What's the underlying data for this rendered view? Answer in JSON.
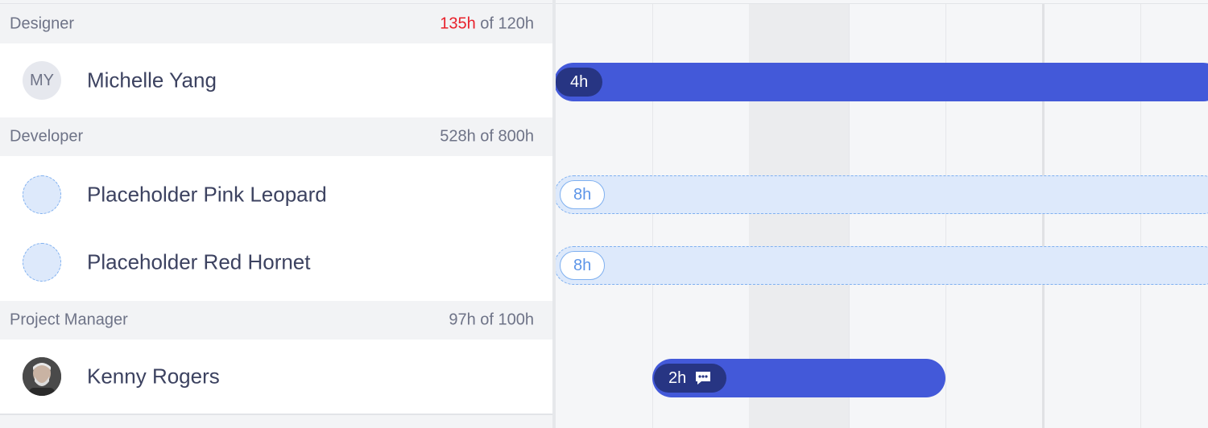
{
  "roles": [
    {
      "name": "Designer",
      "hours_used": "135h",
      "hours_rest": " of 120h",
      "over_budget": true,
      "people": [
        {
          "name": "Michelle Yang",
          "avatar_type": "initials",
          "initials": "MY",
          "booking_label": "4h"
        }
      ]
    },
    {
      "name": "Developer",
      "hours_used": "528h",
      "hours_rest": " of 800h",
      "over_budget": false,
      "people": [
        {
          "name": "Placeholder Pink Leopard",
          "avatar_type": "placeholder",
          "booking_label": "8h"
        },
        {
          "name": "Placeholder Red Hornet",
          "avatar_type": "placeholder",
          "booking_label": "8h"
        }
      ]
    },
    {
      "name": "Project Manager",
      "hours_used": "97h",
      "hours_rest": " of 100h",
      "over_budget": false,
      "people": [
        {
          "name": "Kenny Rogers",
          "avatar_type": "photo",
          "booking_label": "2h",
          "booking_icon": "comment-icon"
        }
      ]
    }
  ],
  "colors": {
    "over_budget": "#e8212b",
    "booking_solid": "#4359d9",
    "booking_pill": "#273583",
    "placeholder_fill": "#dde9fb",
    "placeholder_border": "#7fb0f0"
  }
}
